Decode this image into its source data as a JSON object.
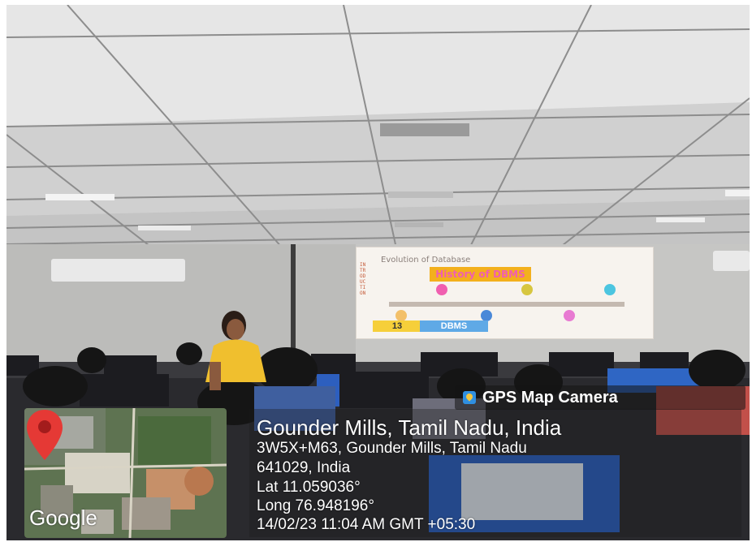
{
  "photo": {
    "description_icon": "classroom-photo",
    "slide": {
      "title": "Evolution of Database",
      "side_text": "INTRODUCTION",
      "banner": "History of DBMS",
      "number": "13",
      "label": "DBMS"
    }
  },
  "gps": {
    "brand_icon": "gps-map-camera-icon",
    "brand": "GPS Map Camera",
    "location": "Gounder Mills, Tamil Nadu, India",
    "address_line1": "3W5X+M63, Gounder Mills, Tamil Nadu",
    "address_line2": "641029, India",
    "lat": "Lat 11.059036°",
    "long": "Long 76.948196°",
    "datetime": "14/02/23 11:04 AM GMT +05:30",
    "map": {
      "provider": "Google",
      "pin_icon": "map-pin-icon",
      "pin_color": "#e53935"
    }
  }
}
